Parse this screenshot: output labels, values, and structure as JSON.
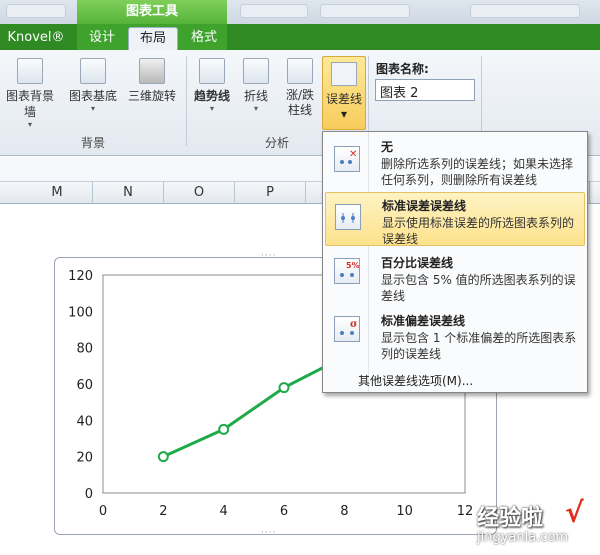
{
  "context_tab_title": "图表工具",
  "tabs": [
    {
      "label": "Knovel®",
      "active": false
    },
    {
      "label": "设计",
      "active": false
    },
    {
      "label": "布局",
      "active": true
    },
    {
      "label": "格式",
      "active": false
    }
  ],
  "ribbon": {
    "background_group": {
      "label": "背景",
      "buttons": [
        "图表背景墙",
        "图表基底",
        "三维旋转"
      ]
    },
    "analysis_group": {
      "label": "分析",
      "buttons": [
        "趋势线",
        "折线",
        "涨/跌",
        "柱线",
        "误差线"
      ]
    },
    "chart_name": {
      "title": "图表名称:",
      "value": "图表 2"
    }
  },
  "columns": [
    "M",
    "N",
    "O",
    "P"
  ],
  "dropdown": {
    "items": [
      {
        "title": "无",
        "desc": "删除所选系列的误差线；如果未选择任何系列，则删除所有误差线"
      },
      {
        "title": "标准误差误差线",
        "desc": "显示使用标准误差的所选图表系列的误差线",
        "highlighted": true
      },
      {
        "title": "百分比误差线",
        "desc": "显示包含 5% 值的所选图表系列的误差线",
        "icon_text": "5%"
      },
      {
        "title": "标准偏差误差线",
        "desc": "显示包含 1 个标准偏差的所选图表系列的误差线",
        "icon_text": "σ"
      }
    ],
    "more": "其他误差线选项(M)..."
  },
  "chart_data": {
    "type": "line",
    "x": [
      2,
      4,
      6,
      8
    ],
    "series": [
      {
        "values": [
          20,
          35,
          58,
          75
        ],
        "color": "#1faa4a"
      }
    ],
    "xlim": [
      0,
      12
    ],
    "ylim": [
      0,
      120
    ],
    "xticks": [
      "0",
      "2",
      "4",
      "6",
      "8",
      "10",
      "12"
    ],
    "yticks": [
      "0",
      "20",
      "40",
      "60",
      "80",
      "100",
      "120"
    ],
    "grid": false
  },
  "watermark": {
    "text": "经验啦",
    "check": "√",
    "sub": "jingyanla.com"
  }
}
